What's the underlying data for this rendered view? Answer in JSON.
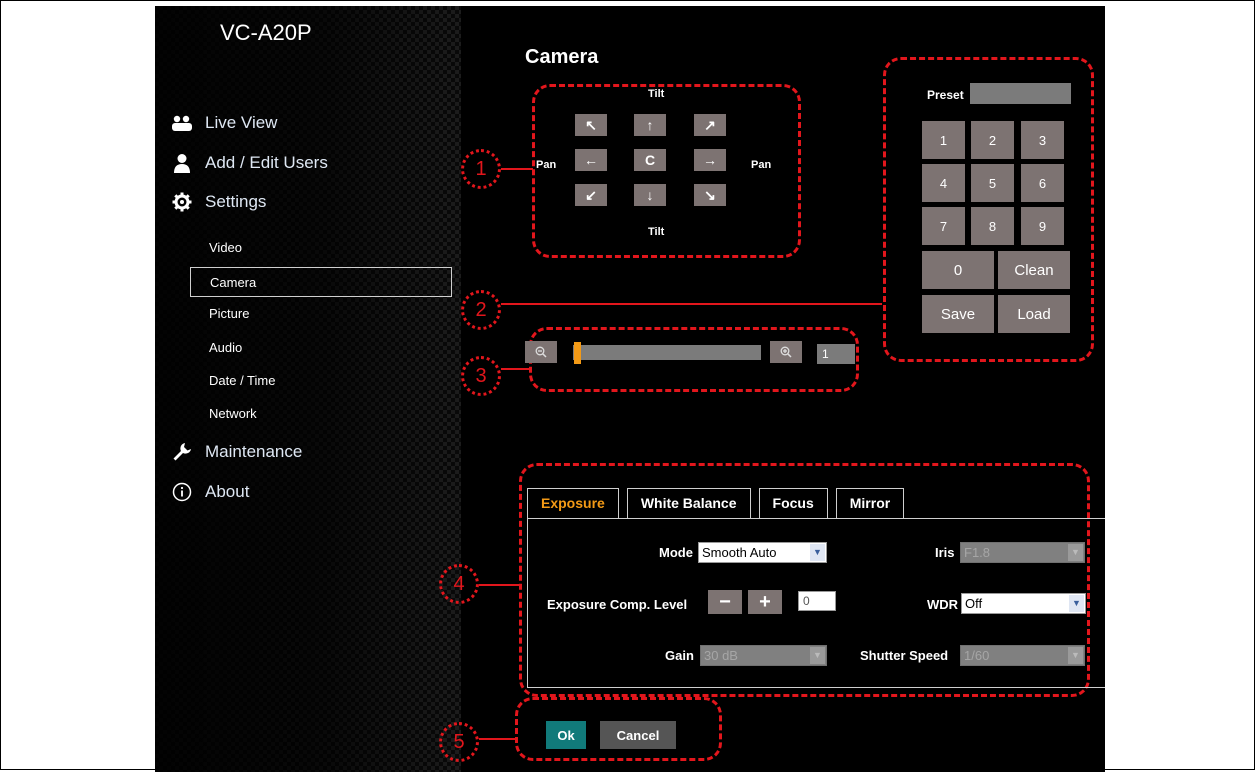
{
  "app": {
    "title": "VC-A20P"
  },
  "nav": {
    "main": [
      {
        "label": "Live View",
        "icon": "live-view-icon"
      },
      {
        "label": "Add / Edit Users",
        "icon": "user-icon"
      },
      {
        "label": "Settings",
        "icon": "gear-icon"
      }
    ],
    "settings_sub": [
      "Video",
      "Camera",
      "Picture",
      "Audio",
      "Date / Time",
      "Network"
    ],
    "active_sub": "Camera",
    "bottom": [
      {
        "label": "Maintenance",
        "icon": "wrench-icon"
      },
      {
        "label": "About",
        "icon": "info-icon"
      }
    ]
  },
  "page": {
    "title": "Camera"
  },
  "ptz": {
    "tilt_label": "Tilt",
    "pan_label": "Pan",
    "buttons": {
      "up_left": "↖",
      "up": "↑",
      "up_right": "↗",
      "left": "←",
      "center": "C",
      "right": "→",
      "down_left": "↙",
      "down": "↓",
      "down_right": "↘"
    }
  },
  "preset": {
    "label": "Preset",
    "keys": [
      "1",
      "2",
      "3",
      "4",
      "5",
      "6",
      "7",
      "8",
      "9"
    ],
    "zero": "0",
    "clean": "Clean",
    "save": "Save",
    "load": "Load"
  },
  "zoom": {
    "out_icon": "zoom-out-icon",
    "in_icon": "zoom-in-icon",
    "value": "1",
    "level_fraction": 0.0
  },
  "tabs": [
    "Exposure",
    "White Balance",
    "Focus",
    "Mirror"
  ],
  "active_tab": "Exposure",
  "exposure": {
    "mode_label": "Mode",
    "mode_value": "Smooth Auto",
    "iris_label": "Iris",
    "iris_value": "F1.8",
    "comp_label": "Exposure Comp. Level",
    "comp_minus": "−",
    "comp_plus": "+",
    "comp_value": "0",
    "wdr_label": "WDR",
    "wdr_value": "Off",
    "gain_label": "Gain",
    "gain_value": "30 dB",
    "shutter_label": "Shutter Speed",
    "shutter_value": "1/60"
  },
  "footer": {
    "ok": "Ok",
    "cancel": "Cancel"
  },
  "callouts": [
    "1",
    "2",
    "3",
    "4",
    "5"
  ],
  "colors": {
    "accent": "#f39a16",
    "callout": "#e2161c",
    "ok": "#117a7a",
    "button": "#7d7372"
  }
}
